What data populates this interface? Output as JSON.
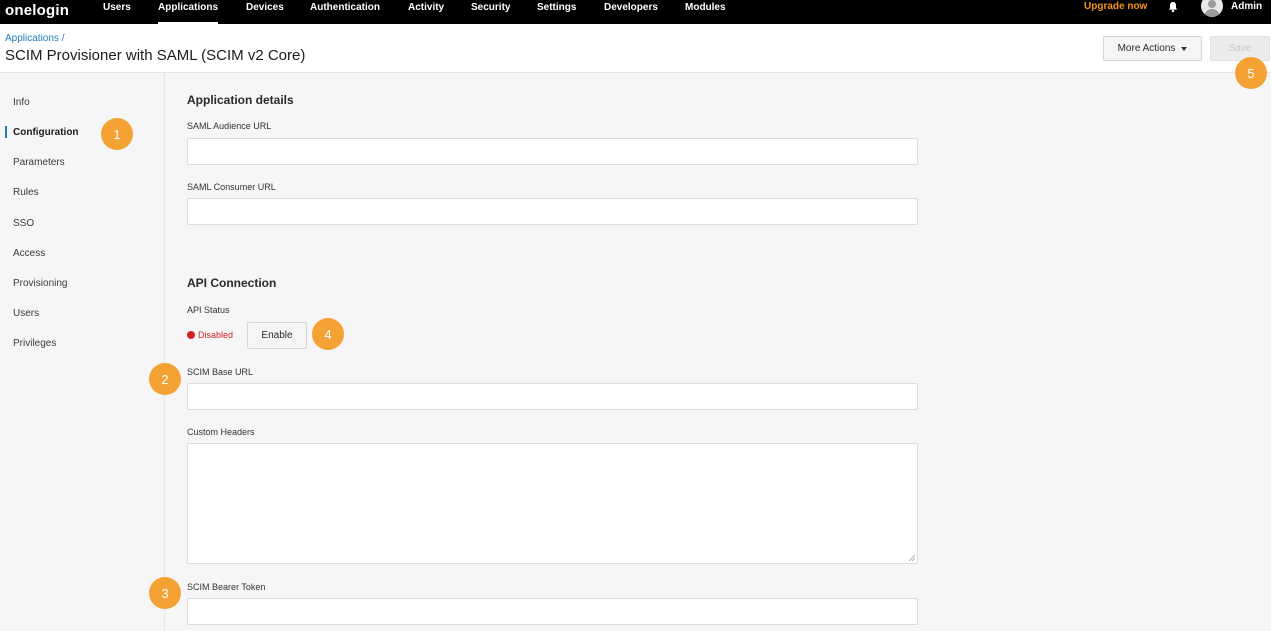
{
  "topnav": {
    "logo": "onelogin",
    "items": [
      {
        "label": "Users"
      },
      {
        "label": "Applications"
      },
      {
        "label": "Devices"
      },
      {
        "label": "Authentication"
      },
      {
        "label": "Activity"
      },
      {
        "label": "Security"
      },
      {
        "label": "Settings"
      },
      {
        "label": "Developers"
      },
      {
        "label": "Modules"
      }
    ],
    "active_item": "Applications",
    "upgrade_label": "Upgrade now",
    "user_name": "Admin",
    "icons": [
      "bell-icon",
      "avatar-icon"
    ],
    "upgrade_color": "#f7931e"
  },
  "header": {
    "breadcrumb": "Applications /",
    "title": "SCIM Provisioner with SAML (SCIM v2 Core)",
    "more_actions_label": "More Actions",
    "save_label": "Save",
    "save_disabled": true
  },
  "sidebar": {
    "active_item": "Configuration",
    "items": [
      {
        "label": "Info"
      },
      {
        "label": "Configuration"
      },
      {
        "label": "Parameters"
      },
      {
        "label": "Rules"
      },
      {
        "label": "SSO"
      },
      {
        "label": "Access"
      },
      {
        "label": "Provisioning"
      },
      {
        "label": "Users"
      },
      {
        "label": "Privileges"
      }
    ]
  },
  "main": {
    "app_details": {
      "title": "Application details",
      "saml_audience_label": "SAML Audience URL",
      "saml_audience_value": "",
      "saml_consumer_label": "SAML Consumer URL",
      "saml_consumer_value": ""
    },
    "api_connection": {
      "title": "API Connection",
      "status_label": "API Status",
      "status_value": "Disabled",
      "status_color": "#d12222",
      "enable_label": "Enable",
      "scim_base_url_label": "SCIM Base URL",
      "scim_base_url_value": "",
      "custom_headers_label": "Custom Headers",
      "custom_headers_value": "",
      "bearer_token_label": "SCIM Bearer Token",
      "bearer_token_value": ""
    }
  },
  "callouts": [
    {
      "number": "1"
    },
    {
      "number": "2"
    },
    {
      "number": "3"
    },
    {
      "number": "4"
    },
    {
      "number": "5"
    }
  ],
  "accent_color": "#f4a234",
  "link_color": "#1f7ec0"
}
